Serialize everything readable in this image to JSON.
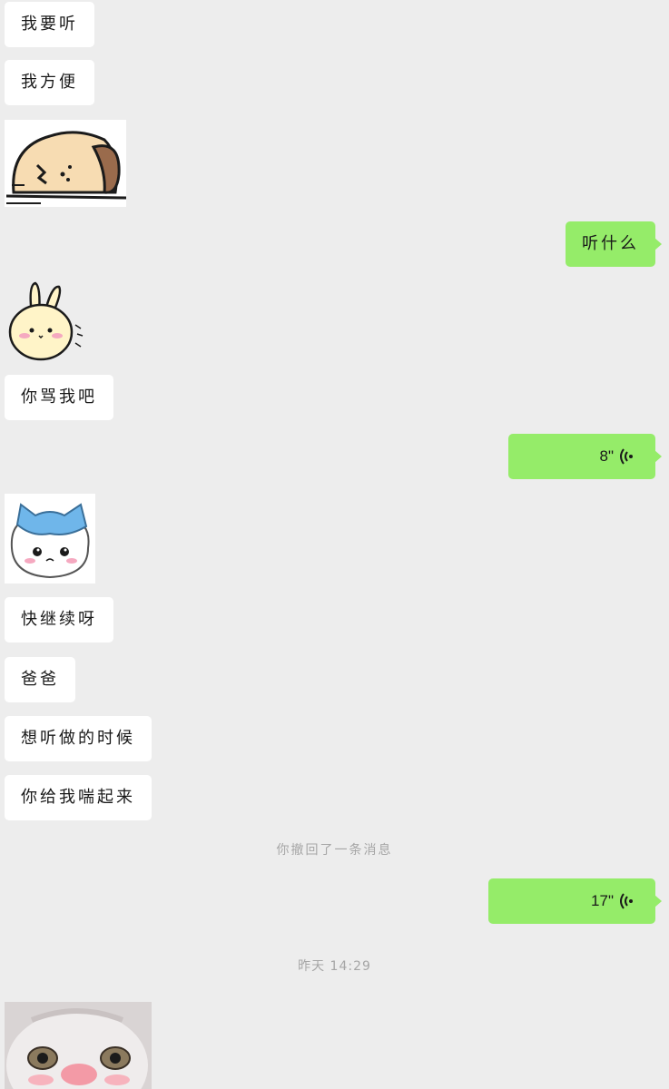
{
  "messages": {
    "m1": "我要听",
    "m2": "我方便",
    "m3": "听什么",
    "m4": "你骂我吧",
    "m5_duration": "8\"",
    "m6": "快继续呀",
    "m7": "爸爸",
    "m8": "想听做的时候",
    "m9": "你给我喘起来",
    "m10_duration": "17\""
  },
  "system": {
    "recall_notice": "你撤回了一条消息",
    "timestamp": "昨天 14:29"
  },
  "stickers": {
    "s1": "sleeping-dog-sticker",
    "s2": "bunny-sticker",
    "s3": "blue-hat-cat-sticker",
    "s4": "crying-cat-photo-sticker"
  },
  "colors": {
    "background": "#ededed",
    "incoming_bubble": "#ffffff",
    "outgoing_bubble": "#95ec69",
    "system_text": "#a6a6a6"
  }
}
